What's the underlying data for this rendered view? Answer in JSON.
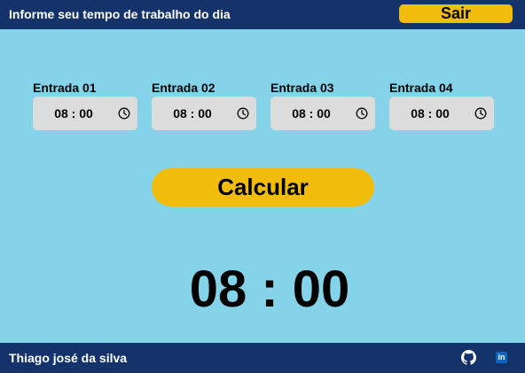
{
  "header": {
    "title": "Informe seu tempo de trabalho do dia",
    "logout_label": "Sair"
  },
  "entries": [
    {
      "label": "Entrada 01",
      "value": "08 : 00",
      "icon": "clock-icon"
    },
    {
      "label": "Entrada 02",
      "value": "08 : 00",
      "icon": "clock-icon"
    },
    {
      "label": "Entrada 03",
      "value": "08 : 00",
      "icon": "clock-icon"
    },
    {
      "label": "Entrada 04",
      "value": "08 : 00",
      "icon": "clock-icon"
    }
  ],
  "calculate_label": "Calcular",
  "result": "08 : 00",
  "footer": {
    "name": "Thiago josé da silva",
    "github_icon": "github-icon",
    "linkedin_icon": "linkedin-icon",
    "linkedin_text": "in"
  },
  "colors": {
    "background": "#84d3e8",
    "bar": "#14336a",
    "accent": "#f2bd0a",
    "input": "#dcdcdc"
  }
}
